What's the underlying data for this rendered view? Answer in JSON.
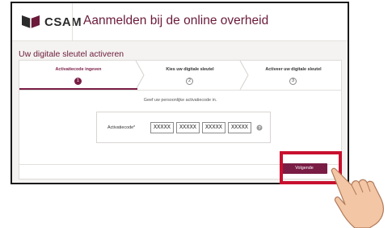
{
  "header": {
    "logo_text": "CSAM",
    "title": "Aanmelden bij de online overheid"
  },
  "page": {
    "section_title": "Uw digitale sleutel activeren"
  },
  "steps": [
    {
      "label": "Activatiecode ingeven",
      "number": "1",
      "active": true
    },
    {
      "label": "Kies uw digitale sleutel",
      "number": "2",
      "active": false
    },
    {
      "label": "Activeer uw digitale sleutel",
      "number": "3",
      "active": false
    }
  ],
  "form": {
    "instruction": "Geef uw persoonlijke activatiecode in.",
    "code_label": "Activatiecode*",
    "code_fields": [
      "XXXXX",
      "XXXXX",
      "XXXXX",
      "XXXXX"
    ]
  },
  "footer": {
    "next_label": "Volgende"
  },
  "colors": {
    "brand": "#7a1d45",
    "highlight": "#c8102e"
  },
  "icons": [
    "csam-logo-icon",
    "help-icon",
    "pointing-hand-icon"
  ]
}
